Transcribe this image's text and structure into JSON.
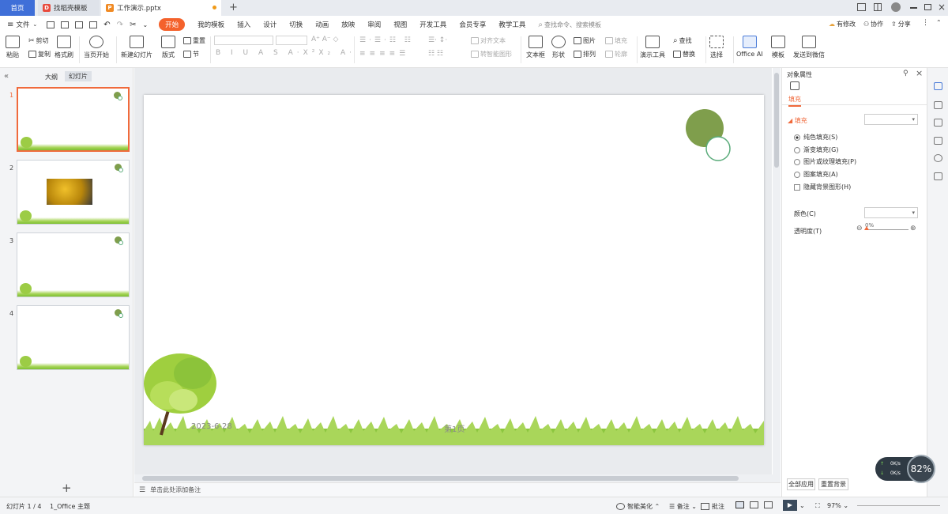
{
  "tabs": {
    "home": "首页",
    "template": "找稻壳模板",
    "active_doc": "工作演示.pptx",
    "new_tab": "+"
  },
  "window": {
    "icons": [
      "layout-icon",
      "grid-icon",
      "avatar",
      "minimize-icon",
      "restore-icon",
      "close-icon"
    ]
  },
  "menu": {
    "file": "文件",
    "items": [
      "开始",
      "我的模板",
      "插入",
      "设计",
      "切换",
      "动画",
      "放映",
      "审阅",
      "视图",
      "开发工具",
      "会员专享",
      "教学工具"
    ],
    "active_index": 0,
    "search": "查找命令、搜索模板",
    "changes": "有修改",
    "collab": "协作",
    "share": "分享"
  },
  "ribbon": {
    "paste": "粘贴",
    "cut": "剪切",
    "copy": "复制",
    "format_painter": "格式刷",
    "from_current": "当页开始",
    "new_slide": "新建幻灯片",
    "layout": "版式",
    "reset": "重置",
    "section": "节",
    "font_name": "",
    "font_size": "",
    "align_text": "对齐文本",
    "smart_art": "转智能图形",
    "text_box": "文本框",
    "shape": "形状",
    "picture": "图片",
    "arrange": "排列",
    "fill": "填充",
    "outline": "轮廓",
    "presenter_tools": "演示工具",
    "find": "查找",
    "replace": "替换",
    "select": "选择",
    "office_ai": "Office AI",
    "template": "模板",
    "send_wechat": "发送到微信"
  },
  "left_panel": {
    "outline_tab": "大纲",
    "slides_tab": "幻灯片",
    "slide_numbers": [
      "1",
      "2",
      "3",
      "4"
    ],
    "selected": 1,
    "add": "+"
  },
  "slide": {
    "date": "2023-6-28",
    "page": "第1页"
  },
  "notes": {
    "placeholder": "单击此处添加备注"
  },
  "panel": {
    "title": "对象属性",
    "tab": "填充",
    "section": "填充",
    "options": [
      "纯色填充(S)",
      "渐变填充(G)",
      "图片或纹理填充(P)",
      "图案填充(A)"
    ],
    "selected_option": 0,
    "hide_bg": "隐藏背景图形(H)",
    "color_label": "颜色(C)",
    "transparency_label": "透明度(T)",
    "transparency_value": "0%",
    "apply_all": "全部应用",
    "reset_bg": "重置背景"
  },
  "status": {
    "slide_count": "幻灯片 1 / 4",
    "theme": "1_Office 主题",
    "smart": "智能美化",
    "notes": "备注",
    "comments": "批注",
    "zoom": "97%"
  },
  "network": {
    "up": "0K/s",
    "down": "0K/s",
    "percent": "82%"
  },
  "colors": {
    "accent": "#f4622c",
    "home_tab": "#3f6fd8",
    "circle": "#7f9e4c",
    "ring": "#5aab7a",
    "grass": "#8cc63f"
  }
}
